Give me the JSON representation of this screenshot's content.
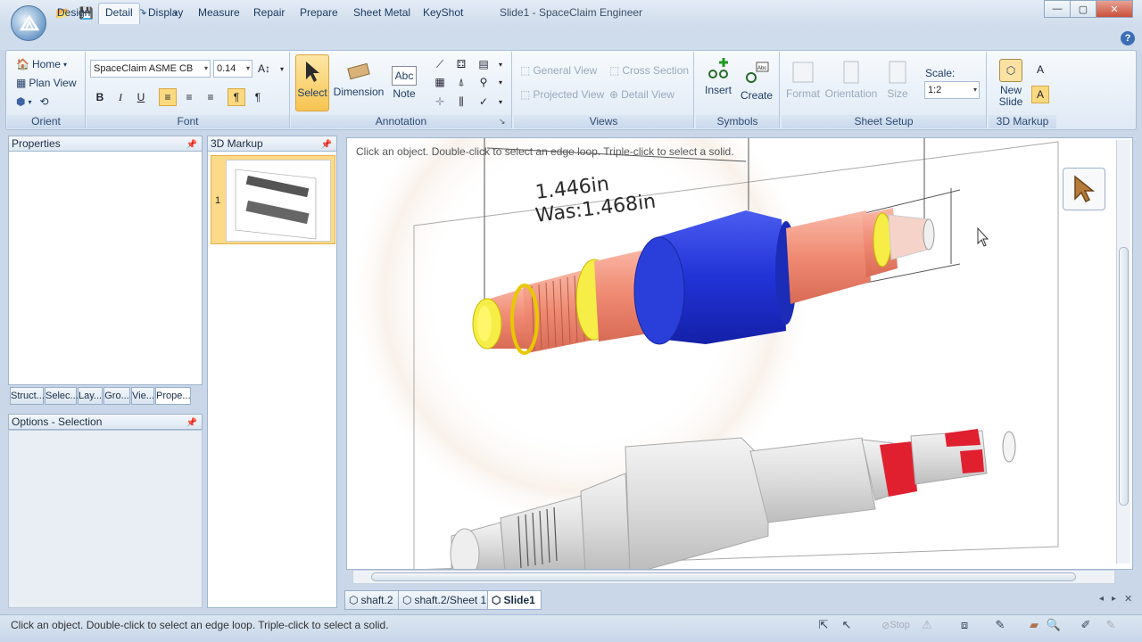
{
  "window": {
    "title": "Slide1 - SpaceClaim Engineer",
    "controls": [
      "minimize",
      "maximize",
      "close"
    ]
  },
  "quick_access": {
    "icons": [
      "open-icon",
      "save-icon",
      "undo-icon",
      "redo-icon",
      "customize-icon"
    ]
  },
  "menu_tabs": [
    "Design",
    "Detail",
    "Display",
    "Measure",
    "Repair",
    "Prepare",
    "Sheet Metal",
    "KeyShot"
  ],
  "active_tab": "Detail",
  "ribbon": {
    "orient": {
      "label": "Orient",
      "home": "Home",
      "plan_view": "Plan View"
    },
    "font": {
      "label": "Font",
      "font_name": "SpaceClaim ASME CB",
      "font_size": "0.14",
      "bold": "B",
      "italic": "I",
      "underline": "U"
    },
    "annotation": {
      "label": "Annotation",
      "select": "Select",
      "dimension": "Dimension",
      "note": "Note",
      "note_icon_text": "Abc"
    },
    "views": {
      "label": "Views",
      "general_view": "General View",
      "cross_section": "Cross Section",
      "projected_view": "Projected View",
      "detail_view": "Detail View"
    },
    "symbols": {
      "label": "Symbols",
      "insert": "Insert",
      "create": "Create"
    },
    "sheet_setup": {
      "label": "Sheet Setup",
      "format": "Format",
      "orientation": "Orientation",
      "size": "Size",
      "scale_label": "Scale:",
      "scale_value": "1:2"
    },
    "markup_3d": {
      "label": "3D Markup",
      "new_slide": "New Slide"
    }
  },
  "panels": {
    "properties": "Properties",
    "markup": "3D Markup",
    "slide_number": "1",
    "bottom_tabs": [
      "Struct...",
      "Selec...",
      "Lay...",
      "Gro...",
      "Vie...",
      "Prope..."
    ],
    "options": "Options - Selection"
  },
  "canvas": {
    "hint": "Click an object. Double-click to select an edge loop. Triple-click to select a solid.",
    "dimension_current": "1.446in",
    "dimension_was": "Was:1.468in"
  },
  "doc_tabs": [
    "shaft.2",
    "shaft.2/Sheet 1",
    "Slide1"
  ],
  "active_doc_tab": "Slide1",
  "status": {
    "text": "Click an object. Double-click to select an edge loop. Triple-click to select a solid.",
    "stop": "Stop"
  },
  "colors": {
    "accent_blue": "#2a3fd9",
    "salmon": "#f3917d",
    "yellow": "#f5f04a",
    "red": "#e0202f",
    "ribbon_bg": "#dfe9f5"
  }
}
